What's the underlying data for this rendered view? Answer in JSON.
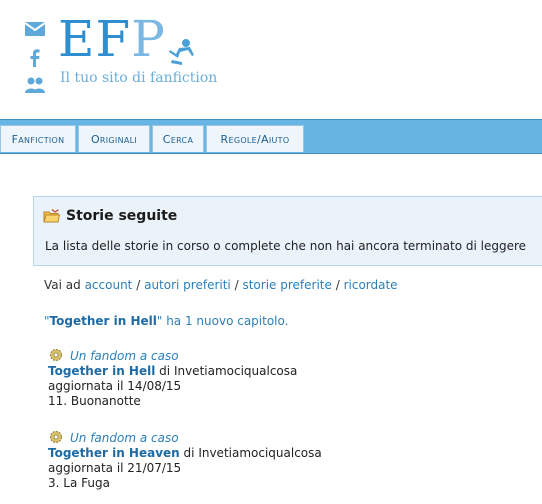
{
  "header": {
    "logo_main": "EF",
    "logo_tail": "P",
    "tagline": "Il tuo sito di fanfiction",
    "side_icons": [
      "mail-icon",
      "facebook-icon",
      "community-icon"
    ]
  },
  "nav": {
    "tabs": [
      "Fanfiction",
      "Originali",
      "Cerca",
      "Regole/Aiuto"
    ]
  },
  "panel": {
    "title": "Storie seguite",
    "description": "La lista delle storie in corso o complete che non hai ancora terminato di leggere"
  },
  "links": {
    "prefix": "Vai ad",
    "items": [
      "account",
      "autori preferiti",
      "storie preferite",
      "ricordate"
    ],
    "separator": "/"
  },
  "notice": {
    "open_quote": "\"",
    "story": "Together in Hell",
    "rest": "\" ha 1 nuovo capitolo."
  },
  "stories": [
    {
      "fandom": "Un fandom a caso",
      "title": "Together in Hell",
      "by": "di",
      "author": "Invetiamociqualcosa",
      "updated": "aggiornata il 14/08/15",
      "chapter": "11. Buonanotte"
    },
    {
      "fandom": "Un fandom a caso",
      "title": "Together in Heaven",
      "by": "di",
      "author": "Invetiamociqualcosa",
      "updated": "aggiornata il 21/07/15",
      "chapter": "3. La Fuga"
    }
  ],
  "colors": {
    "accent": "#2e8ed0",
    "navbar": "#68b4e2",
    "link": "#2c7fb8",
    "panel_bg": "#eaf2fa"
  }
}
